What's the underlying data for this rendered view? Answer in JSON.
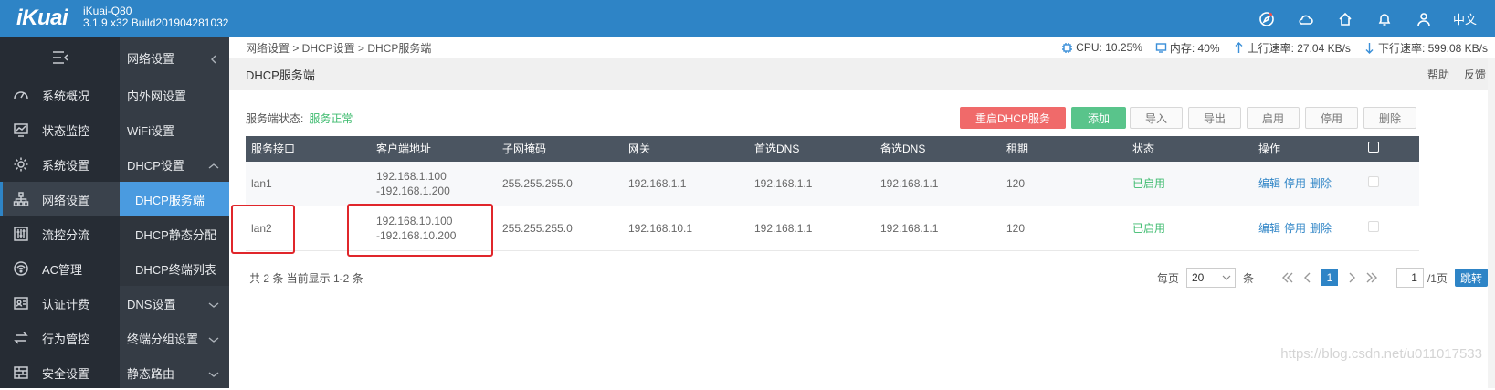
{
  "header": {
    "logo": "iKuai",
    "model": "iKuai-Q80",
    "version": "3.1.9 x32 Build201904281032",
    "lang": "中文",
    "icons": [
      "compass-icon",
      "cloud-icon",
      "home-icon",
      "bell-icon",
      "user-icon"
    ]
  },
  "sidebar1": {
    "items": [
      {
        "label": "系统概况",
        "icon": "dashboard-icon"
      },
      {
        "label": "状态监控",
        "icon": "monitor-icon"
      },
      {
        "label": "系统设置",
        "icon": "gear-icon"
      },
      {
        "label": "网络设置",
        "icon": "network-icon"
      },
      {
        "label": "流控分流",
        "icon": "sliders-icon"
      },
      {
        "label": "AC管理",
        "icon": "wifi-icon"
      },
      {
        "label": "认证计费",
        "icon": "id-card-icon"
      },
      {
        "label": "行为管控",
        "icon": "transfer-icon"
      },
      {
        "label": "安全设置",
        "icon": "firewall-icon"
      }
    ]
  },
  "sidebar2": {
    "head": "网络设置",
    "items": [
      {
        "label": "内外网设置"
      },
      {
        "label": "WiFi设置"
      },
      {
        "label": "DHCP设置"
      },
      {
        "label": "DHCP服务端"
      },
      {
        "label": "DHCP静态分配"
      },
      {
        "label": "DHCP终端列表"
      },
      {
        "label": "DNS设置"
      },
      {
        "label": "终端分组设置"
      },
      {
        "label": "静态路由"
      }
    ]
  },
  "breadcrumb": "网络设置 > DHCP设置 > DHCP服务端",
  "stats": {
    "cpu": "CPU: 10.25%",
    "mem": "内存: 40%",
    "up": "上行速率: 27.04 KB/s",
    "down": "下行速率: 599.08 KB/s"
  },
  "page": {
    "title": "DHCP服务端",
    "help": "帮助",
    "feedback": "反馈",
    "status_label": "服务端状态:",
    "status_value": "服务正常"
  },
  "toolbar": {
    "restart": "重启DHCP服务",
    "add": "添加",
    "import": "导入",
    "export": "导出",
    "enable": "启用",
    "disable": "停用",
    "delete": "删除"
  },
  "table": {
    "headers": [
      "服务接口",
      "客户端地址",
      "子网掩码",
      "网关",
      "首选DNS",
      "备选DNS",
      "租期",
      "状态",
      "操作"
    ],
    "rows": [
      {
        "iface": "lan1",
        "addr_start": "192.168.1.100",
        "addr_end": "-192.168.1.200",
        "mask": "255.255.255.0",
        "gateway": "192.168.1.1",
        "dns1": "192.168.1.1",
        "dns2": "192.168.1.1",
        "lease": "120",
        "status": "已启用",
        "ops": [
          "编辑",
          "停用",
          "删除"
        ]
      },
      {
        "iface": "lan2",
        "addr_start": "192.168.10.100",
        "addr_end": "-192.168.10.200",
        "mask": "255.255.255.0",
        "gateway": "192.168.10.1",
        "dns1": "192.168.1.1",
        "dns2": "192.168.1.1",
        "lease": "120",
        "status": "已启用",
        "ops": [
          "编辑",
          "停用",
          "删除"
        ]
      }
    ]
  },
  "footer": {
    "summary": "共 2 条 当前显示 1-2 条",
    "per_page_label": "每页",
    "per_page_value": "20",
    "unit": "条",
    "current_page": "1",
    "page_input": "1",
    "total_pages": "/1页",
    "go": "跳转"
  },
  "watermark": "https://blog.csdn.net/u011017533",
  "colors": {
    "topbar": "#2e84c6",
    "sidebar": "#262c34",
    "active": "#4a9be0",
    "ok": "#3dbb6e",
    "danger": "#f06a6a",
    "highlight": "#e0262b"
  }
}
